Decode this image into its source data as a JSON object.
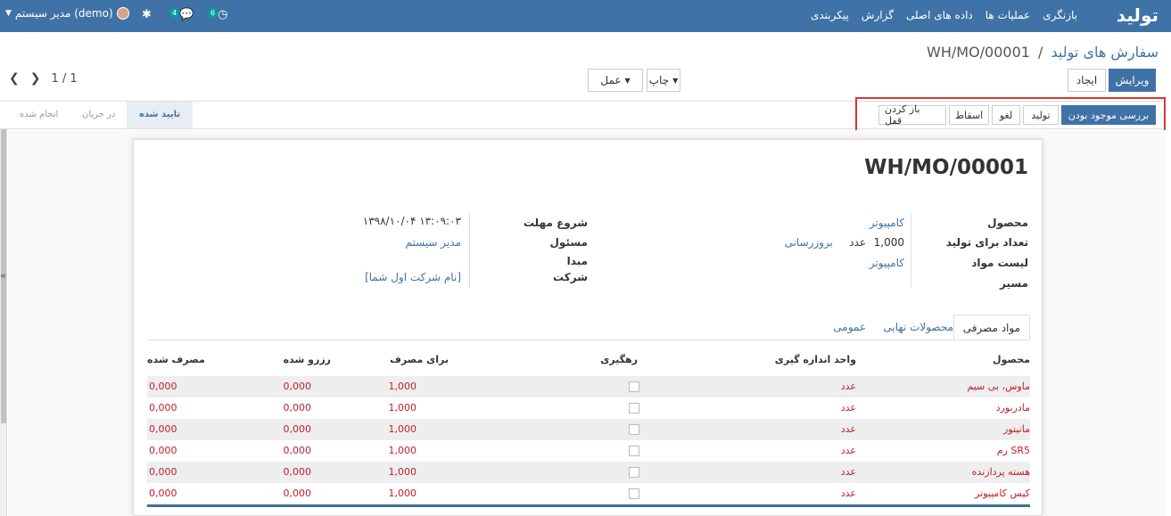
{
  "nav": {
    "brand": "تولید",
    "menu": [
      "بازنگری",
      "عملیات ها",
      "داده های اصلی",
      "گزارش",
      "پیکربندی"
    ],
    "user": "مدیر سیستم (demo)",
    "chat_count": "4",
    "activity_count": "6"
  },
  "breadcrumb": {
    "parent": "سفارش های تولید",
    "separator": "/",
    "current": "WH/MO/00001"
  },
  "buttons": {
    "edit": "ویرایش",
    "create": "ایجاد",
    "print": "چاپ",
    "action": "عمل"
  },
  "pager": {
    "value": "1 / 1"
  },
  "header_buttons": {
    "check_availability": "بررسی موجود بودن",
    "produce": "تولید",
    "cancel": "لغو",
    "scrap": "اسقاط",
    "unlock": "باز کردن قفل"
  },
  "stages": {
    "confirmed": "تایید شده",
    "in_progress": "در جریان",
    "done": "انجام شده"
  },
  "doc": {
    "title": "WH/MO/00001",
    "product_label": "محصول",
    "product_value": "کامپیوتر",
    "qty_label": "تعداد برای تولید",
    "qty_value": "1,000",
    "qty_uom": "عدد",
    "qty_update": "بروزرسانی",
    "bom_label": "لیست مواد",
    "bom_value": "کامپیوتر",
    "route_label": "مسیر",
    "deadline_label": "شروع مهلت",
    "deadline_value": "۱۳۹۸/۱۰/۰۴ ۱۳:۰۹:۰۳",
    "responsible_label": "مسئول",
    "responsible_value": "مدیر سیستم",
    "source_label": "مبدا",
    "company_label": "شرکت",
    "company_value": "[نام شرکت اول شما]"
  },
  "tabs": [
    "مواد مصرفی",
    "محصولات نهایی",
    "عمومی"
  ],
  "table": {
    "headers": [
      "محصول",
      "واحد اندازه گیری",
      "رهگیری",
      "برای مصرف",
      "رزرو شده",
      "مصرف شده"
    ],
    "rows": [
      {
        "product": "ماوس، بی سیم",
        "uom": "عدد",
        "to_consume": "1,000",
        "reserved": "0,000",
        "consumed": "0,000"
      },
      {
        "product": "مادربورد",
        "uom": "عدد",
        "to_consume": "1,000",
        "reserved": "0,000",
        "consumed": "0,000"
      },
      {
        "product": "مانیتور",
        "uom": "عدد",
        "to_consume": "1,000",
        "reserved": "0,000",
        "consumed": "0,000"
      },
      {
        "product": "رم SR5",
        "uom": "عدد",
        "to_consume": "1,000",
        "reserved": "0,000",
        "consumed": "0,000"
      },
      {
        "product": "هسته پردازنده",
        "uom": "عدد",
        "to_consume": "1,000",
        "reserved": "0,000",
        "consumed": "0,000"
      },
      {
        "product": "کیس کامپیوتر",
        "uom": "عدد",
        "to_consume": "1,000",
        "reserved": "0,000",
        "consumed": "0,000"
      }
    ]
  },
  "colors": {
    "primary": "#3f72a6",
    "alert_red": "#d93636",
    "row_text": "#c0202c"
  }
}
